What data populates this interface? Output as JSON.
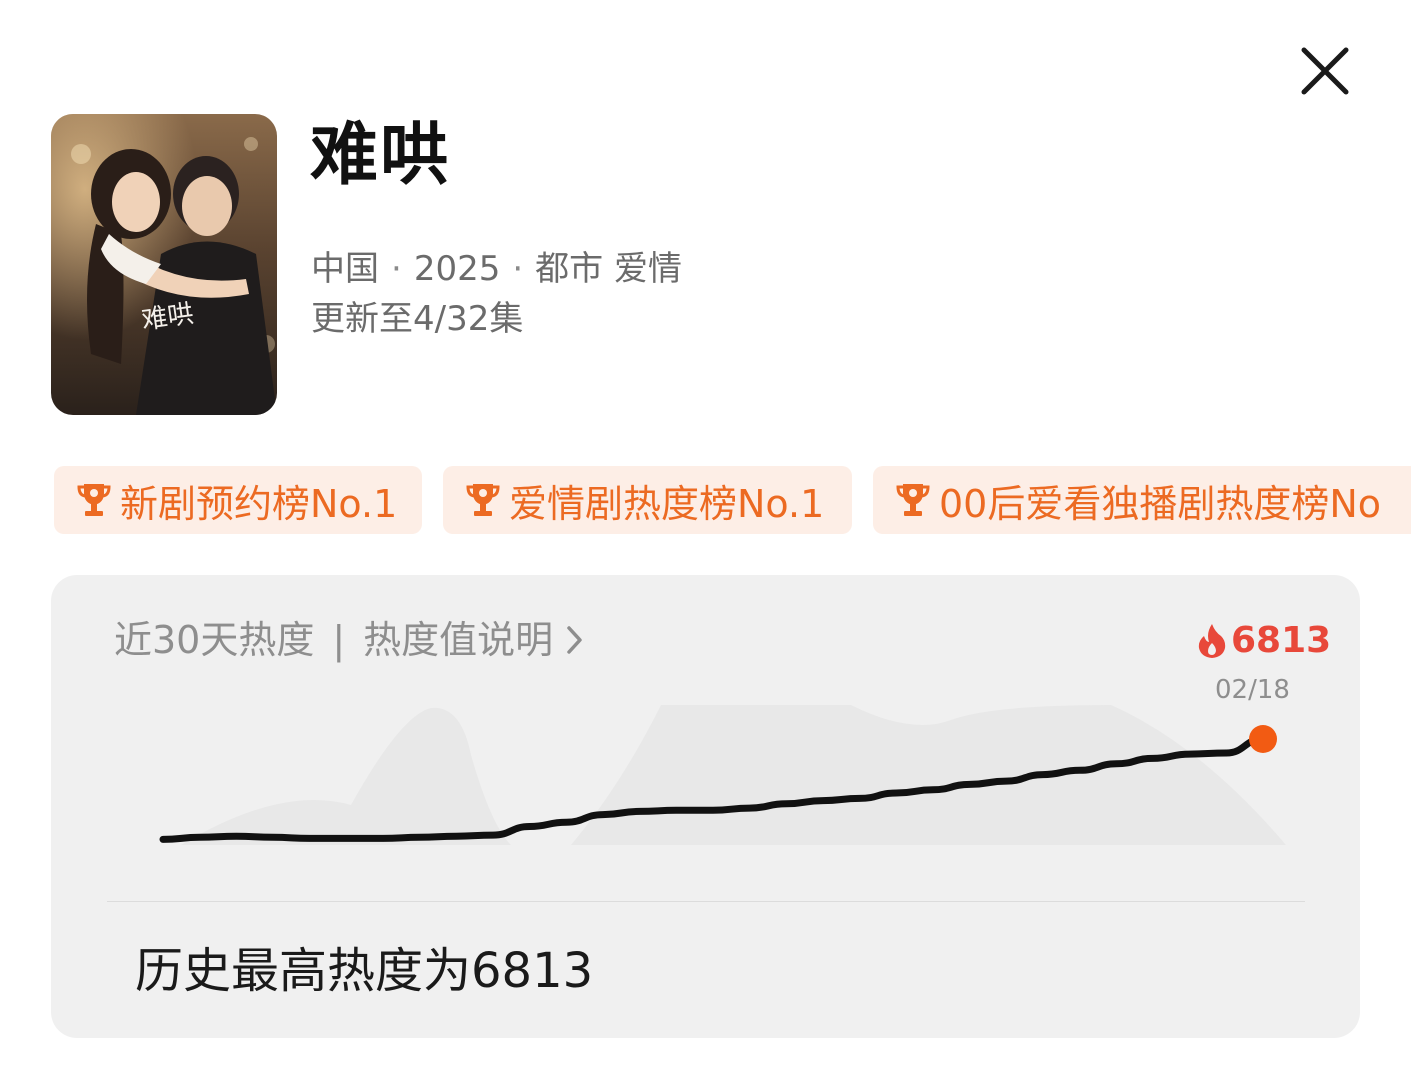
{
  "show": {
    "title": "难哄",
    "country": "中国",
    "year": "2025",
    "genres": "都市 爱情",
    "separator": "·",
    "update_status": "更新至4/32集",
    "poster_text": "难哄"
  },
  "badges": [
    {
      "label": "新剧预约榜No.1",
      "icon": "trophy-icon"
    },
    {
      "label": "爱情剧热度榜No.1",
      "icon": "trophy-icon"
    },
    {
      "label": "00后爱看独播剧热度榜No",
      "icon": "trophy-icon"
    }
  ],
  "heat": {
    "period_label": "近30天热度",
    "divider": "|",
    "explain_link": "热度值说明",
    "current_value": "6813",
    "current_date": "02/18",
    "max_text": "历史最高热度为6813"
  },
  "colors": {
    "accent_orange": "#ec6a22",
    "badge_bg": "#fdeee6",
    "heat_red": "#e8483a",
    "endpoint_dot": "#f25b13",
    "card_bg": "#f0f0f0"
  },
  "icons": {
    "close": "close-icon",
    "chevron": "chevron-right-icon",
    "flame": "flame-icon"
  },
  "chart_data": {
    "type": "line",
    "series": [
      {
        "values": [
          0.07,
          0.09,
          0.1,
          0.09,
          0.08,
          0.08,
          0.08,
          0.09,
          0.1,
          0.11,
          0.19,
          0.23,
          0.3,
          0.33,
          0.34,
          0.34,
          0.36,
          0.4,
          0.43,
          0.45,
          0.5,
          0.53,
          0.58,
          0.61,
          0.67,
          0.71,
          0.77,
          0.82,
          0.86,
          0.87,
          1.0
        ]
      }
    ],
    "end_value": 6813,
    "end_label": "02/18",
    "grid": false
  }
}
